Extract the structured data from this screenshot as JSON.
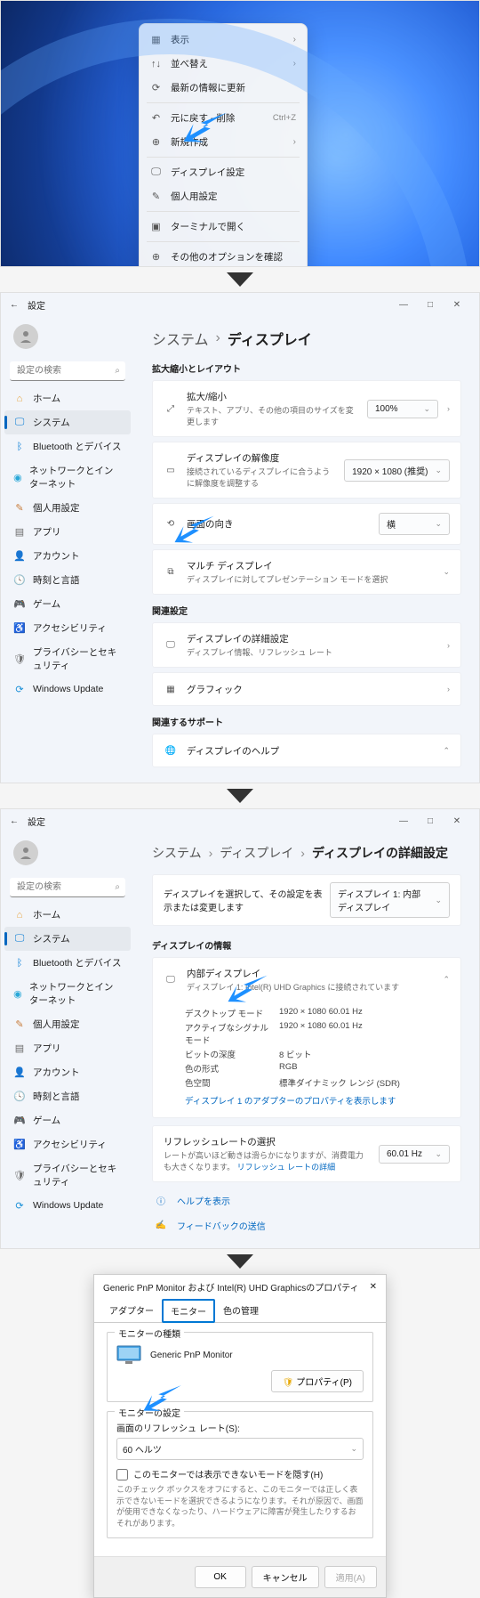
{
  "ctx": {
    "view": "表示",
    "sort": "並べ替え",
    "refresh": "最新の情報に更新",
    "undo": "元に戻す - 削除",
    "undo_short": "Ctrl+Z",
    "new": "新規作成",
    "display": "ディスプレイ設定",
    "personalize": "個人用設定",
    "terminal": "ターミナルで開く",
    "more": "その他のオプションを確認"
  },
  "win": {
    "back": "←",
    "title": "設定",
    "min": "—",
    "max": "□",
    "close": "✕"
  },
  "search": {
    "ph": "設定の検索"
  },
  "nav": {
    "home": "ホーム",
    "system": "システム",
    "bt": "Bluetooth とデバイス",
    "net": "ネットワークとインターネット",
    "pers": "個人用設定",
    "apps": "アプリ",
    "acct": "アカウント",
    "time": "時刻と言語",
    "game": "ゲーム",
    "acc": "アクセシビリティ",
    "priv": "プライバシーとセキュリティ",
    "wu": "Windows Update"
  },
  "p1": {
    "crumb_sys": "システム",
    "crumb_disp": "ディスプレイ",
    "sect_layout": "拡大縮小とレイアウト",
    "scale_t": "拡大/縮小",
    "scale_s": "テキスト、アプリ、その他の項目のサイズを変更します",
    "scale_v": "100%",
    "res_t": "ディスプレイの解像度",
    "res_s": "接続されているディスプレイに合うように解像度を調整する",
    "res_v": "1920 × 1080 (推奨)",
    "orient_t": "画面の向き",
    "orient_v": "横",
    "multi_t": "マルチ ディスプレイ",
    "multi_s": "ディスプレイに対してプレゼンテーション モードを選択",
    "sect_rel": "関連設定",
    "adv_t": "ディスプレイの詳細設定",
    "adv_s": "ディスプレイ情報、リフレッシュ レート",
    "gfx_t": "グラフィック",
    "sect_sup": "関連するサポート",
    "help_t": "ディスプレイのヘルプ"
  },
  "p2": {
    "crumb_sys": "システム",
    "crumb_disp": "ディスプレイ",
    "crumb_adv": "ディスプレイの詳細設定",
    "select_note": "ディスプレイを選択して、その設定を表示または変更します",
    "select_val": "ディスプレイ 1: 内部ディスプレイ",
    "sect_info": "ディスプレイの情報",
    "int_t": "内部ディスプレイ",
    "int_s": "ディスプレイ 1: Intel(R) UHD Graphics に接続されています",
    "k_desk": "デスクトップ モード",
    "v_desk": "1920 × 1080 60.01 Hz",
    "k_sig": "アクティブなシグナル モード",
    "v_sig": "1920 × 1080 60.01 Hz",
    "k_depth": "ビットの深度",
    "v_depth": "8 ビット",
    "k_fmt": "色の形式",
    "v_fmt": "RGB",
    "k_space": "色空間",
    "v_space": "標準ダイナミック レンジ (SDR)",
    "adapter_link": "ディスプレイ 1 のアダプターのプロパティを表示します",
    "rr_t": "リフレッシュレートの選択",
    "rr_s": "レートが高いほど動きは滑らかになりますが、消費電力も大きくなります。",
    "rr_link": "リフレッシュ レートの詳細",
    "rr_v": "60.01 Hz",
    "help": "ヘルプを表示",
    "feedback": "フィードバックの送信"
  },
  "dlg": {
    "title": "Generic PnP Monitor および Intel(R) UHD Graphicsのプロパティ",
    "close": "✕",
    "tab_adapter": "アダプター",
    "tab_monitor": "モニター",
    "tab_color": "色の管理",
    "grp_montype": "モニターの種類",
    "mon_name": "Generic PnP Monitor",
    "prop_btn": "プロパティ(P)",
    "grp_monset": "モニターの設定",
    "rr_label": "画面のリフレッシュ レート(S):",
    "rr_val": "60 ヘルツ",
    "hide_chk": "このモニターでは表示できないモードを隠す(H)",
    "hide_note": "このチェック ボックスをオフにすると、このモニターでは正しく表示できないモードを選択できるようになります。それが原因で、画面が使用できなくなったり、ハードウェアに障害が発生したりするおそれがあります。",
    "ok": "OK",
    "cancel": "キャンセル",
    "apply": "適用(A)"
  }
}
